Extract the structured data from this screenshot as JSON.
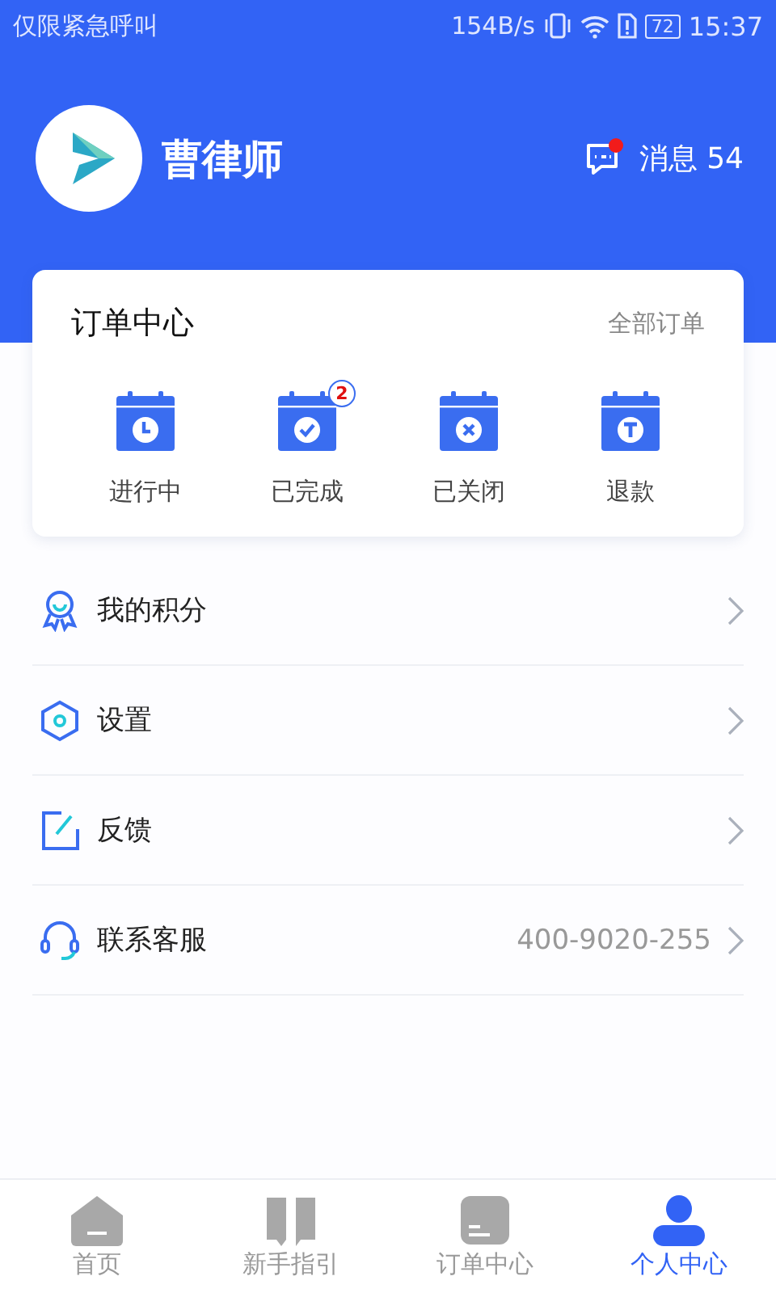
{
  "status_bar": {
    "carrier": "仅限紧急呼叫",
    "speed": "154B/s",
    "battery": "72",
    "time": "15:37"
  },
  "profile": {
    "name": "曹律师",
    "messages_label": "消息 54",
    "messages_unread": true
  },
  "orders": {
    "title": "订单中心",
    "all_link": "全部订单",
    "items": [
      {
        "kind": "clock",
        "label": "进行中"
      },
      {
        "kind": "check",
        "label": "已完成",
        "badge": "2"
      },
      {
        "kind": "cross",
        "label": "已关闭"
      },
      {
        "kind": "t",
        "label": "退款"
      }
    ]
  },
  "menu": [
    {
      "kind": "medal",
      "label": "我的积分"
    },
    {
      "kind": "hexagon",
      "label": "设置"
    },
    {
      "kind": "edit",
      "label": "反馈"
    },
    {
      "kind": "headset",
      "label": "联系客服",
      "value": "400-9020-255"
    }
  ],
  "tab_bar": [
    {
      "kind": "home",
      "label": "首页",
      "selected": false
    },
    {
      "kind": "book",
      "label": "新手指引",
      "selected": false
    },
    {
      "kind": "doc",
      "label": "订单中心",
      "selected": false
    },
    {
      "kind": "person",
      "label": "个人中心",
      "selected": true
    }
  ]
}
